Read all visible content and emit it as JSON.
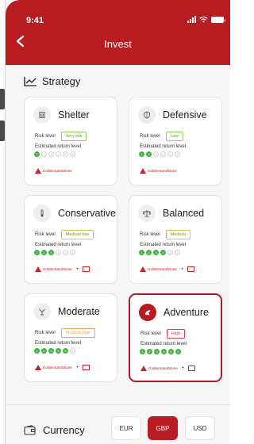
{
  "status_bar": {
    "time": "9:41"
  },
  "header": {
    "title": "Invest"
  },
  "strategy": {
    "title": "Strategy"
  },
  "labels": {
    "risk_level": "Risk level",
    "estimated_return": "Estimated return level",
    "partner_primary": "GoldenSandStone",
    "partner_plus": "+"
  },
  "cards": [
    {
      "name": "Shelter",
      "icon": "shield-house-icon",
      "risk": "Very low",
      "return_level": 1,
      "has_second_partner": false,
      "selected": false,
      "accent": "#8fcf4f"
    },
    {
      "name": "Defensive",
      "icon": "shield-icon",
      "risk": "Low",
      "return_level": 2,
      "has_second_partner": false,
      "selected": false,
      "accent": "#8fcf4f"
    },
    {
      "name": "Conservative",
      "icon": "thermometer-icon",
      "risk": "Medium low",
      "return_level": 3,
      "has_second_partner": true,
      "selected": false,
      "accent": "#c9c94a"
    },
    {
      "name": "Balanced",
      "icon": "scale-icon",
      "risk": "Medium",
      "return_level": 4,
      "has_second_partner": true,
      "selected": false,
      "accent": "#c9c94a"
    },
    {
      "name": "Moderate",
      "icon": "scales-icon",
      "risk": "Medium high",
      "return_level": 5,
      "has_second_partner": true,
      "selected": false,
      "accent": "#f2a65a"
    },
    {
      "name": "Adventure",
      "icon": "adventure-icon",
      "risk": "High",
      "return_level": 6,
      "has_second_partner": true,
      "selected": true,
      "accent": "#e0434b"
    }
  ],
  "dot_numbers": [
    "1",
    "2",
    "3",
    "4",
    "5",
    "6"
  ],
  "currency": {
    "title": "Currency",
    "options": [
      "EUR",
      "GBP",
      "USD"
    ],
    "selected": "GBP"
  },
  "colors": {
    "brand_red": "#b81c22",
    "green": "#41b43f"
  }
}
